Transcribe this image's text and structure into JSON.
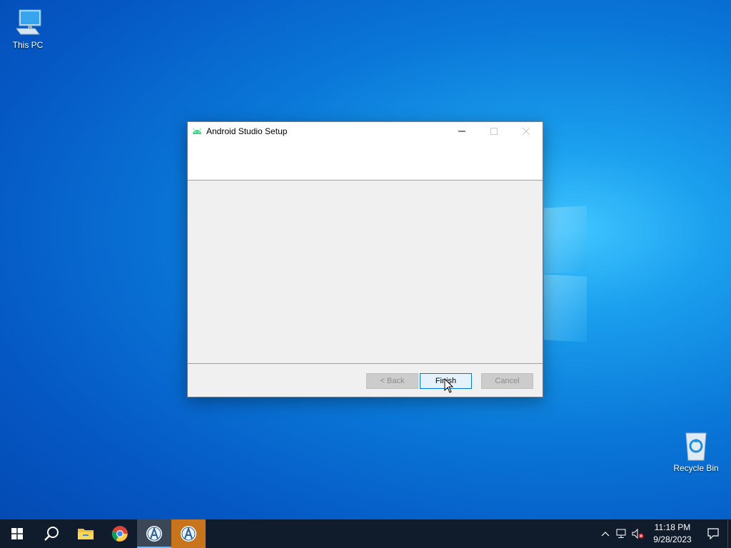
{
  "desktop": {
    "icons": [
      {
        "label": "This PC",
        "icon": "computer-icon"
      },
      {
        "label": "Recycle Bin",
        "icon": "recycle-bin-icon"
      }
    ]
  },
  "dialog": {
    "title": "Android Studio Setup",
    "app_icon": "android-icon",
    "buttons": {
      "back": "< Back",
      "finish": "Finish",
      "cancel": "Cancel"
    }
  },
  "taskbar": {
    "items": [
      {
        "name": "start-button",
        "icon": "windows-icon"
      },
      {
        "name": "search-button",
        "icon": "search-icon"
      },
      {
        "name": "file-explorer",
        "icon": "folder-icon"
      },
      {
        "name": "chrome",
        "icon": "chrome-icon"
      },
      {
        "name": "android-studio-setup",
        "icon": "android-studio-icon",
        "state": "active"
      },
      {
        "name": "android-studio",
        "icon": "android-studio-icon",
        "state": "highlighted"
      }
    ],
    "clock": {
      "time": "11:18 PM",
      "date": "9/28/2023"
    }
  },
  "colors": {
    "accent": "#0078d7",
    "taskbar": "#101c2c",
    "highlight": "#c8741c"
  }
}
